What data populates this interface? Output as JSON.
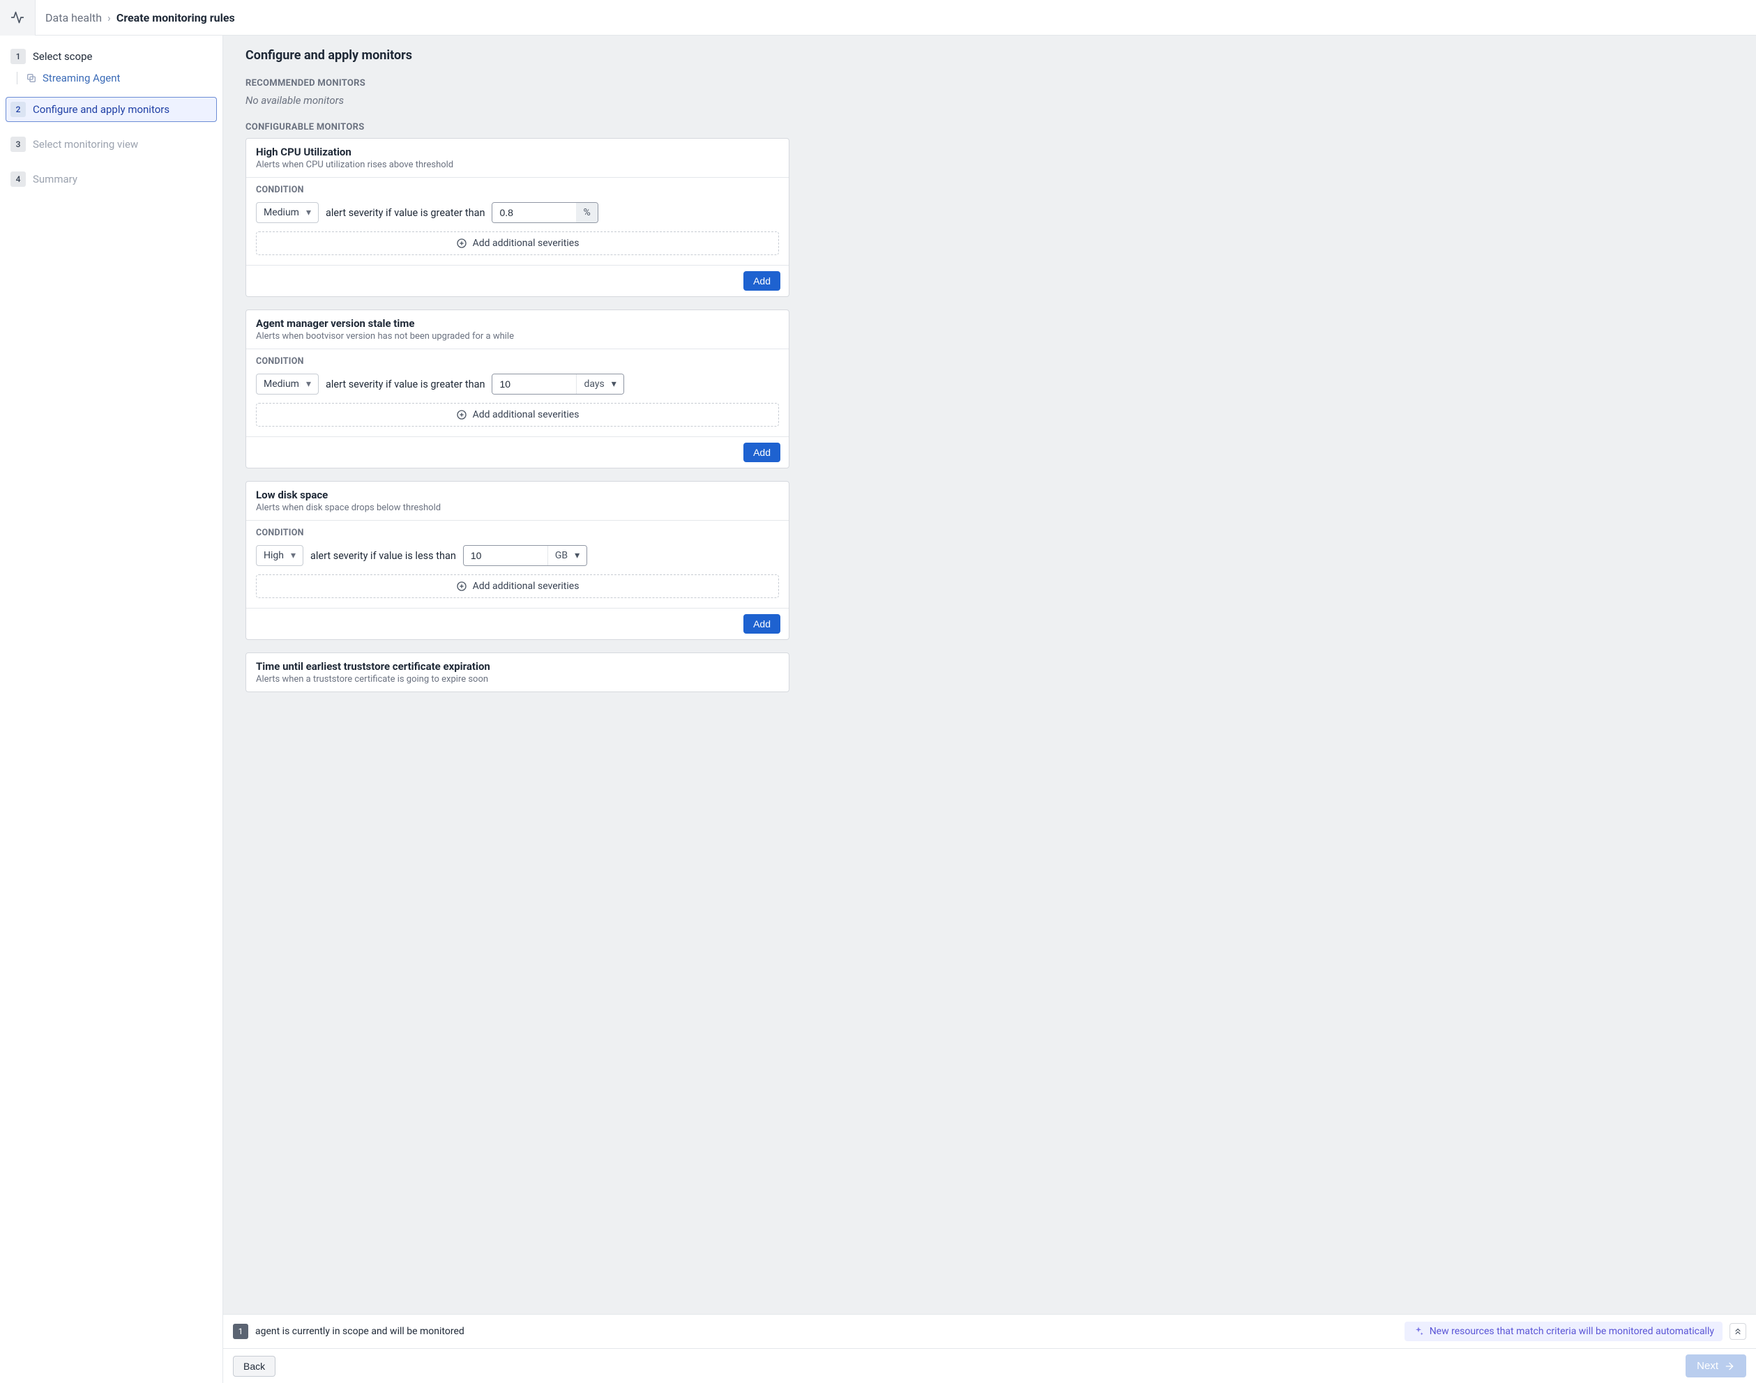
{
  "breadcrumb": {
    "root": "Data health",
    "current": "Create monitoring rules"
  },
  "sidebar": {
    "steps": [
      {
        "num": "1",
        "label": "Select scope",
        "sub": "Streaming Agent"
      },
      {
        "num": "2",
        "label": "Configure and apply monitors"
      },
      {
        "num": "3",
        "label": "Select monitoring view"
      },
      {
        "num": "4",
        "label": "Summary"
      }
    ]
  },
  "page": {
    "title": "Configure and apply monitors",
    "recommended_label": "RECOMMENDED MONITORS",
    "no_available": "No available monitors",
    "configurable_label": "CONFIGURABLE MONITORS",
    "add_severities": "Add additional severities",
    "add_button": "Add",
    "condition_label": "CONDITION"
  },
  "monitors": [
    {
      "title": "High CPU Utilization",
      "desc": "Alerts when CPU utilization rises above threshold",
      "severity": "Medium",
      "sentence": "alert severity if value is greater than",
      "value": "0.8",
      "unit": "%",
      "unit_is_select": false
    },
    {
      "title": "Agent manager version stale time",
      "desc": "Alerts when bootvisor version has not been upgraded for a while",
      "severity": "Medium",
      "sentence": "alert severity if value is greater than",
      "value": "10",
      "unit": "days",
      "unit_is_select": true
    },
    {
      "title": "Low disk space",
      "desc": "Alerts when disk space drops below threshold",
      "severity": "High",
      "sentence": "alert severity if value is less than",
      "value": "10",
      "unit": "GB",
      "unit_is_select": true
    },
    {
      "title": "Time until earliest truststore certificate expiration",
      "desc": "Alerts when a truststore certificate is going to expire soon"
    }
  ],
  "footer": {
    "scope_count": "1",
    "scope_text": "agent is currently in scope and will be monitored",
    "auto_text": "New resources that match criteria will be monitored automatically",
    "back": "Back",
    "next": "Next"
  }
}
